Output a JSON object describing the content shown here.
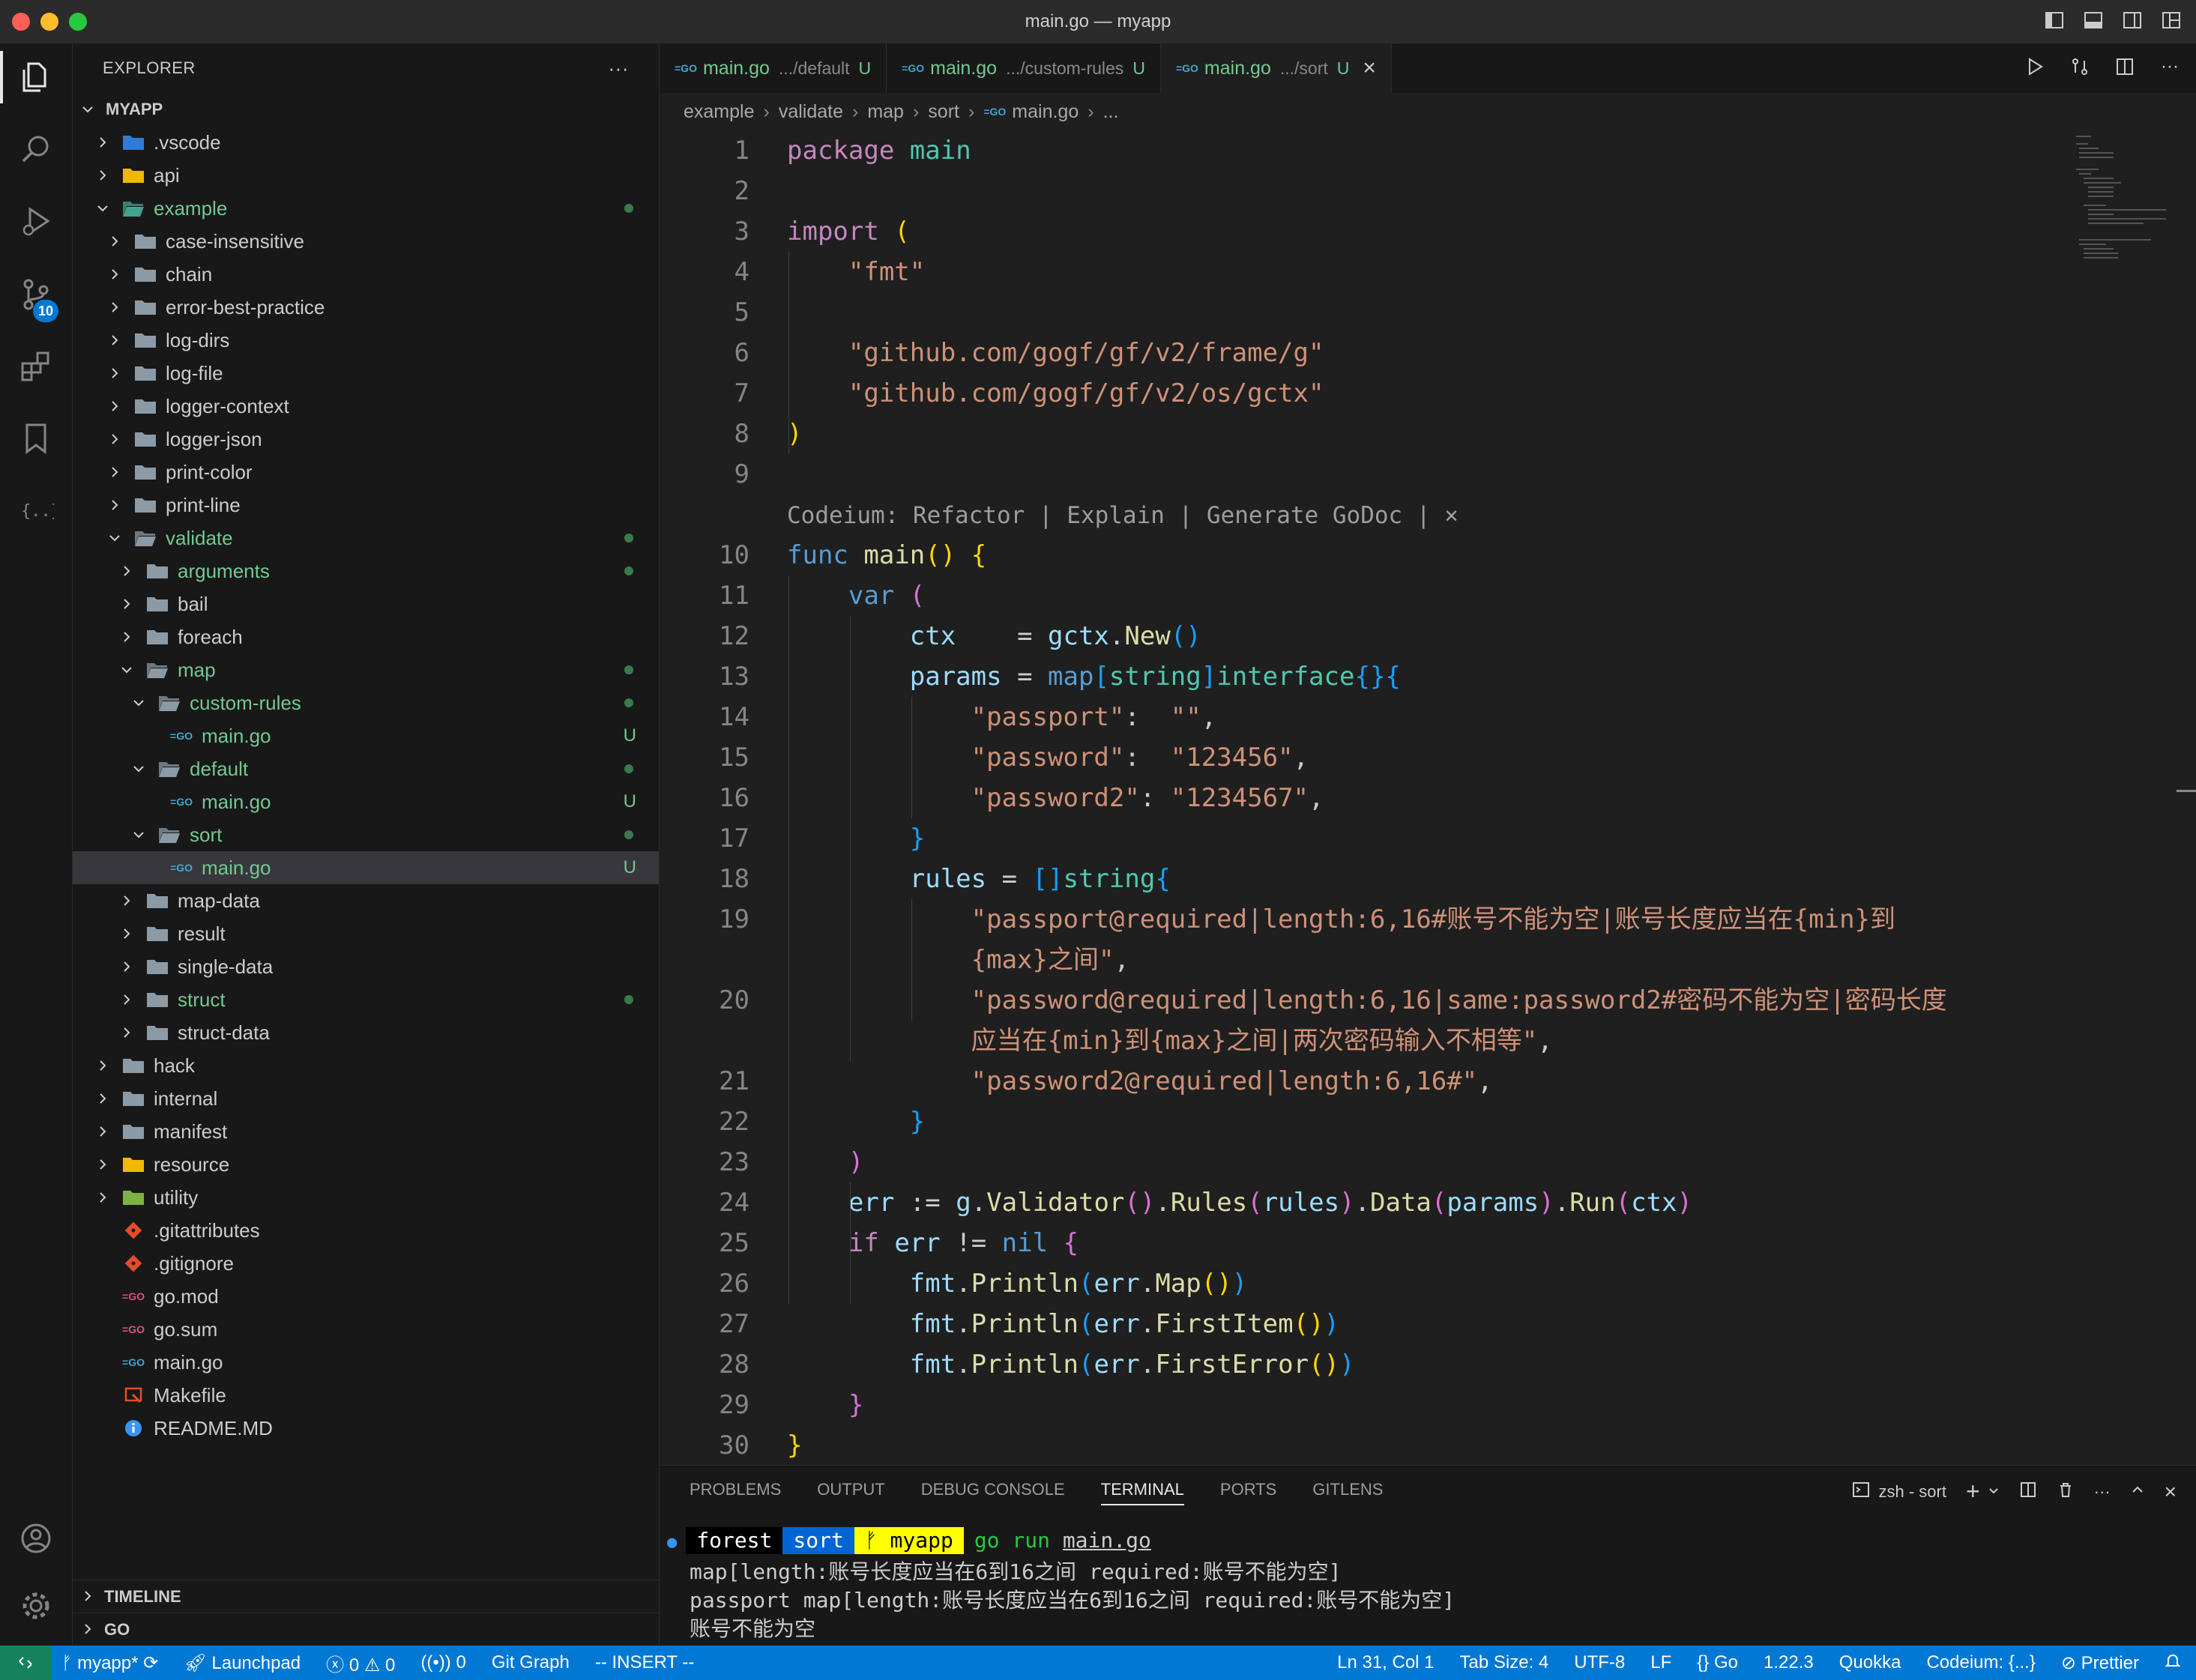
{
  "window": {
    "title": "main.go — myapp"
  },
  "activity_bar": {
    "scm_badge": "10"
  },
  "sidebar": {
    "header": "EXPLORER",
    "more": "···",
    "tree": [
      {
        "label": "MYAPP",
        "depth": 0,
        "kind": "root",
        "open": true,
        "bold": true
      },
      {
        "label": ".vscode",
        "depth": 1,
        "kind": "folder-vscode",
        "open": false
      },
      {
        "label": "api",
        "depth": 1,
        "kind": "folder-api",
        "open": false
      },
      {
        "label": "example",
        "depth": 1,
        "kind": "folder-example",
        "open": true,
        "green": true,
        "dot": true
      },
      {
        "label": "case-insensitive",
        "depth": 2,
        "kind": "folder",
        "open": false
      },
      {
        "label": "chain",
        "depth": 2,
        "kind": "folder",
        "open": false
      },
      {
        "label": "error-best-practice",
        "depth": 2,
        "kind": "folder",
        "open": false
      },
      {
        "label": "log-dirs",
        "depth": 2,
        "kind": "folder",
        "open": false
      },
      {
        "label": "log-file",
        "depth": 2,
        "kind": "folder",
        "open": false
      },
      {
        "label": "logger-context",
        "depth": 2,
        "kind": "folder",
        "open": false
      },
      {
        "label": "logger-json",
        "depth": 2,
        "kind": "folder",
        "open": false
      },
      {
        "label": "print-color",
        "depth": 2,
        "kind": "folder",
        "open": false
      },
      {
        "label": "print-line",
        "depth": 2,
        "kind": "folder",
        "open": false
      },
      {
        "label": "validate",
        "depth": 2,
        "kind": "folder",
        "open": true,
        "green": true,
        "dot": true
      },
      {
        "label": "arguments",
        "depth": 3,
        "kind": "folder",
        "open": false,
        "green": true,
        "dot": true
      },
      {
        "label": "bail",
        "depth": 3,
        "kind": "folder",
        "open": false
      },
      {
        "label": "foreach",
        "depth": 3,
        "kind": "folder",
        "open": false
      },
      {
        "label": "map",
        "depth": 3,
        "kind": "folder",
        "open": true,
        "green": true,
        "dot": true
      },
      {
        "label": "custom-rules",
        "depth": 4,
        "kind": "folder",
        "open": true,
        "green": true,
        "dot": true
      },
      {
        "label": "main.go",
        "depth": 5,
        "kind": "go",
        "green": true,
        "status": "U"
      },
      {
        "label": "default",
        "depth": 4,
        "kind": "folder",
        "open": true,
        "green": true,
        "dot": true
      },
      {
        "label": "main.go",
        "depth": 5,
        "kind": "go",
        "green": true,
        "status": "U"
      },
      {
        "label": "sort",
        "depth": 4,
        "kind": "folder",
        "open": true,
        "green": true,
        "dot": true
      },
      {
        "label": "main.go",
        "depth": 5,
        "kind": "go",
        "green": true,
        "status": "U",
        "selected": true
      },
      {
        "label": "map-data",
        "depth": 3,
        "kind": "folder",
        "open": false
      },
      {
        "label": "result",
        "depth": 3,
        "kind": "folder",
        "open": false
      },
      {
        "label": "single-data",
        "depth": 3,
        "kind": "folder",
        "open": false
      },
      {
        "label": "struct",
        "depth": 3,
        "kind": "folder",
        "open": false,
        "green": true,
        "dot": true
      },
      {
        "label": "struct-data",
        "depth": 3,
        "kind": "folder",
        "open": false
      },
      {
        "label": "hack",
        "depth": 1,
        "kind": "folder",
        "open": false
      },
      {
        "label": "internal",
        "depth": 1,
        "kind": "folder",
        "open": false
      },
      {
        "label": "manifest",
        "depth": 1,
        "kind": "folder",
        "open": false
      },
      {
        "label": "resource",
        "depth": 1,
        "kind": "folder-resource",
        "open": false
      },
      {
        "label": "utility",
        "depth": 1,
        "kind": "folder-utility",
        "open": false
      },
      {
        "label": ".gitattributes",
        "depth": 1,
        "kind": "git"
      },
      {
        "label": ".gitignore",
        "depth": 1,
        "kind": "git"
      },
      {
        "label": "go.mod",
        "depth": 1,
        "kind": "gomod"
      },
      {
        "label": "go.sum",
        "depth": 1,
        "kind": "gomod"
      },
      {
        "label": "main.go",
        "depth": 1,
        "kind": "go"
      },
      {
        "label": "Makefile",
        "depth": 1,
        "kind": "makefile"
      },
      {
        "label": "README.MD",
        "depth": 1,
        "kind": "info"
      }
    ],
    "sections": [
      {
        "label": "TIMELINE"
      },
      {
        "label": "GO"
      }
    ]
  },
  "tabs": [
    {
      "name": "main.go",
      "path": ".../default",
      "status": "U",
      "active": false
    },
    {
      "name": "main.go",
      "path": ".../custom-rules",
      "status": "U",
      "active": false
    },
    {
      "name": "main.go",
      "path": ".../sort",
      "status": "U",
      "active": true
    }
  ],
  "breadcrumb": [
    "example",
    "validate",
    "map",
    "sort",
    "main.go",
    "..."
  ],
  "code": {
    "lens": "Codeium: Refactor | Explain | Generate GoDoc | ×",
    "lines": [
      {
        "n": "1",
        "tokens": [
          [
            "kw",
            "package"
          ],
          [
            "t",
            " "
          ],
          [
            "pkg",
            "main"
          ]
        ]
      },
      {
        "n": "2",
        "tokens": []
      },
      {
        "n": "3",
        "tokens": [
          [
            "kw",
            "import"
          ],
          [
            "t",
            " "
          ],
          [
            "p1",
            "("
          ]
        ]
      },
      {
        "n": "4",
        "tokens": [
          [
            "t",
            "    "
          ],
          [
            "str",
            "\"fmt\""
          ]
        ]
      },
      {
        "n": "5",
        "tokens": []
      },
      {
        "n": "6",
        "tokens": [
          [
            "t",
            "    "
          ],
          [
            "str",
            "\"github.com/gogf/gf/v2/frame/g\""
          ]
        ]
      },
      {
        "n": "7",
        "tokens": [
          [
            "t",
            "    "
          ],
          [
            "str",
            "\"github.com/gogf/gf/v2/os/gctx\""
          ]
        ]
      },
      {
        "n": "8",
        "tokens": [
          [
            "p1",
            ")"
          ]
        ]
      },
      {
        "n": "9",
        "tokens": []
      },
      {
        "n": "",
        "lens": true
      },
      {
        "n": "10",
        "tokens": [
          [
            "blue",
            "func"
          ],
          [
            "t",
            " "
          ],
          [
            "fn",
            "main"
          ],
          [
            "p1",
            "()"
          ],
          [
            "t",
            " "
          ],
          [
            "p1",
            "{"
          ]
        ]
      },
      {
        "n": "11",
        "tokens": [
          [
            "t",
            "    "
          ],
          [
            "blue",
            "var"
          ],
          [
            "t",
            " "
          ],
          [
            "p2",
            "("
          ]
        ]
      },
      {
        "n": "12",
        "tokens": [
          [
            "t",
            "        "
          ],
          [
            "var",
            "ctx"
          ],
          [
            "t",
            "    = "
          ],
          [
            "var",
            "gctx"
          ],
          [
            "t",
            "."
          ],
          [
            "fn",
            "New"
          ],
          [
            "p3",
            "()"
          ]
        ]
      },
      {
        "n": "13",
        "tokens": [
          [
            "t",
            "        "
          ],
          [
            "var",
            "params"
          ],
          [
            "t",
            " = "
          ],
          [
            "blue",
            "map"
          ],
          [
            "p3",
            "["
          ],
          [
            "type",
            "string"
          ],
          [
            "p3",
            "]"
          ],
          [
            "type",
            "interface"
          ],
          [
            "p3",
            "{}{"
          ]
        ]
      },
      {
        "n": "14",
        "tokens": [
          [
            "t",
            "            "
          ],
          [
            "str",
            "\"passport\""
          ],
          [
            "t",
            ":  "
          ],
          [
            "str",
            "\"\""
          ],
          [
            "t",
            ","
          ]
        ]
      },
      {
        "n": "15",
        "tokens": [
          [
            "t",
            "            "
          ],
          [
            "str",
            "\"password\""
          ],
          [
            "t",
            ":  "
          ],
          [
            "str",
            "\"123456\""
          ],
          [
            "t",
            ","
          ]
        ]
      },
      {
        "n": "16",
        "tokens": [
          [
            "t",
            "            "
          ],
          [
            "str",
            "\"password2\""
          ],
          [
            "t",
            ": "
          ],
          [
            "str",
            "\"1234567\""
          ],
          [
            "t",
            ","
          ]
        ]
      },
      {
        "n": "17",
        "tokens": [
          [
            "t",
            "        "
          ],
          [
            "p3",
            "}"
          ]
        ]
      },
      {
        "n": "18",
        "tokens": [
          [
            "t",
            "        "
          ],
          [
            "var",
            "rules"
          ],
          [
            "t",
            " = "
          ],
          [
            "p3",
            "[]"
          ],
          [
            "type",
            "string"
          ],
          [
            "p3",
            "{"
          ]
        ]
      },
      {
        "n": "19",
        "tokens": [
          [
            "t",
            "            "
          ],
          [
            "str",
            "\"passport@required|length:6,16#账号不能为空|账号长度应当在{min}到"
          ]
        ]
      },
      {
        "n": "",
        "tokens": [
          [
            "t",
            "            "
          ],
          [
            "str",
            "{max}之间\""
          ],
          [
            "t",
            ","
          ]
        ]
      },
      {
        "n": "20",
        "tokens": [
          [
            "t",
            "            "
          ],
          [
            "str",
            "\"password@required|length:6,16|same:password2#密码不能为空|密码长度"
          ]
        ]
      },
      {
        "n": "",
        "tokens": [
          [
            "t",
            "            "
          ],
          [
            "str",
            "应当在{min}到{max}之间|两次密码输入不相等\""
          ],
          [
            "t",
            ","
          ]
        ]
      },
      {
        "n": "21",
        "tokens": [
          [
            "t",
            "            "
          ],
          [
            "str",
            "\"password2@required|length:6,16#\""
          ],
          [
            "t",
            ","
          ]
        ]
      },
      {
        "n": "22",
        "tokens": [
          [
            "t",
            "        "
          ],
          [
            "p3",
            "}"
          ]
        ]
      },
      {
        "n": "23",
        "tokens": [
          [
            "t",
            "    "
          ],
          [
            "p2",
            ")"
          ]
        ]
      },
      {
        "n": "24",
        "tokens": [
          [
            "t",
            "    "
          ],
          [
            "var",
            "err"
          ],
          [
            "t",
            " := "
          ],
          [
            "var",
            "g"
          ],
          [
            "t",
            "."
          ],
          [
            "fn",
            "Validator"
          ],
          [
            "p2",
            "()"
          ],
          [
            "t",
            "."
          ],
          [
            "fn",
            "Rules"
          ],
          [
            "p2",
            "("
          ],
          [
            "var",
            "rules"
          ],
          [
            "p2",
            ")"
          ],
          [
            "t",
            "."
          ],
          [
            "fn",
            "Data"
          ],
          [
            "p2",
            "("
          ],
          [
            "var",
            "params"
          ],
          [
            "p2",
            ")"
          ],
          [
            "t",
            "."
          ],
          [
            "fn",
            "Run"
          ],
          [
            "p2",
            "("
          ],
          [
            "var",
            "ctx"
          ],
          [
            "p2",
            ")"
          ]
        ]
      },
      {
        "n": "25",
        "tokens": [
          [
            "t",
            "    "
          ],
          [
            "kw",
            "if"
          ],
          [
            "t",
            " "
          ],
          [
            "var",
            "err"
          ],
          [
            "t",
            " != "
          ],
          [
            "blue",
            "nil"
          ],
          [
            "t",
            " "
          ],
          [
            "p2",
            "{"
          ]
        ]
      },
      {
        "n": "26",
        "tokens": [
          [
            "t",
            "        "
          ],
          [
            "var",
            "fmt"
          ],
          [
            "t",
            "."
          ],
          [
            "fn",
            "Println"
          ],
          [
            "p3",
            "("
          ],
          [
            "var",
            "err"
          ],
          [
            "t",
            "."
          ],
          [
            "fn",
            "Map"
          ],
          [
            "p1",
            "()"
          ],
          [
            "p3",
            ")"
          ]
        ]
      },
      {
        "n": "27",
        "tokens": [
          [
            "t",
            "        "
          ],
          [
            "var",
            "fmt"
          ],
          [
            "t",
            "."
          ],
          [
            "fn",
            "Println"
          ],
          [
            "p3",
            "("
          ],
          [
            "var",
            "err"
          ],
          [
            "t",
            "."
          ],
          [
            "fn",
            "FirstItem"
          ],
          [
            "p1",
            "()"
          ],
          [
            "p3",
            ")"
          ]
        ]
      },
      {
        "n": "28",
        "tokens": [
          [
            "t",
            "        "
          ],
          [
            "var",
            "fmt"
          ],
          [
            "t",
            "."
          ],
          [
            "fn",
            "Println"
          ],
          [
            "p3",
            "("
          ],
          [
            "var",
            "err"
          ],
          [
            "t",
            "."
          ],
          [
            "fn",
            "FirstError"
          ],
          [
            "p1",
            "()"
          ],
          [
            "p3",
            ")"
          ]
        ]
      },
      {
        "n": "29",
        "tokens": [
          [
            "t",
            "    "
          ],
          [
            "p2",
            "}"
          ]
        ]
      },
      {
        "n": "30",
        "tokens": [
          [
            "p1",
            "}"
          ]
        ]
      }
    ]
  },
  "panel": {
    "tabs": [
      "PROBLEMS",
      "OUTPUT",
      "DEBUG CONSOLE",
      "TERMINAL",
      "PORTS",
      "GITLENS"
    ],
    "active_tab": "TERMINAL",
    "terminal_name": "zsh - sort",
    "prompt": {
      "user": "forest",
      "dir": "sort",
      "branch": "myapp",
      "command": "go run",
      "arg": "main.go"
    },
    "output": [
      "map[length:账号长度应当在6到16之间 required:账号不能为空]",
      "passport map[length:账号长度应当在6到16之间 required:账号不能为空]",
      "账号不能为空"
    ]
  },
  "status_bar": {
    "left": [
      "myapp*",
      "Launchpad",
      "0",
      "0",
      "0",
      "Git Graph",
      "-- INSERT --"
    ],
    "right": [
      "Ln 31, Col 1",
      "Tab Size: 4",
      "UTF-8",
      "LF",
      "Go",
      "1.22.3",
      "Quokka",
      "Codeium: {...}",
      "Prettier"
    ]
  },
  "colors": {
    "accent": "#0078d4",
    "remote": "#16825d",
    "git_added": "#73c991"
  }
}
